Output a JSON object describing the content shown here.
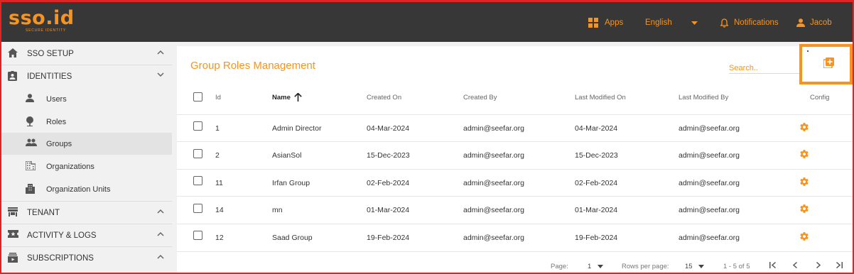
{
  "header": {
    "logo_text": "sso.id",
    "logo_tagline": "SECURE IDENTITY",
    "apps_label": "Apps",
    "language_label": "English",
    "notifications_label": "Notifications",
    "user_label": "Jacob",
    "accent_color": "#f7931e",
    "bar_color": "#373737"
  },
  "sidebar": {
    "items": [
      {
        "label": "SSO SETUP",
        "icon": "home-icon",
        "chevron": "chevron-up-icon"
      },
      {
        "label": "IDENTITIES",
        "icon": "id-badge-icon",
        "chevron": "chevron-down-icon"
      },
      {
        "label": "Users",
        "icon": "person-icon"
      },
      {
        "label": "Roles",
        "icon": "pin-icon"
      },
      {
        "label": "Groups",
        "icon": "people-icon",
        "active": true
      },
      {
        "label": "Organizations",
        "icon": "building-icon"
      },
      {
        "label": "Organization Units",
        "icon": "buildings-icon"
      },
      {
        "label": "TENANT",
        "icon": "store-icon",
        "chevron": "chevron-up-icon"
      },
      {
        "label": "ACTIVITY & LOGS",
        "icon": "ticket-icon",
        "chevron": "chevron-up-icon"
      },
      {
        "label": "SUBSCRIPTIONS",
        "icon": "subscriptions-icon",
        "chevron": "chevron-up-icon"
      }
    ]
  },
  "main": {
    "title": "Group Roles Management",
    "search_placeholder": "Search..",
    "add_button_icon": "add-box-icon"
  },
  "table": {
    "columns": [
      "Id",
      "Name",
      "Created On",
      "Created By",
      "Last Modified On",
      "Last Modified By",
      "Config"
    ],
    "sort_column": "Name",
    "sort_icon": "arrow-up-icon",
    "rows": [
      {
        "id": "1",
        "name": "Admin Director",
        "created_on": "04-Mar-2024",
        "created_by": "admin@seefar.org",
        "modified_on": "04-Mar-2024",
        "modified_by": "admin@seefar.org"
      },
      {
        "id": "2",
        "name": "AsianSol",
        "created_on": "15-Dec-2023",
        "created_by": "admin@seefar.org",
        "modified_on": "15-Dec-2023",
        "modified_by": "admin@seefar.org"
      },
      {
        "id": "11",
        "name": "Irfan Group",
        "created_on": "02-Feb-2024",
        "created_by": "admin@seefar.org",
        "modified_on": "02-Feb-2024",
        "modified_by": "admin@seefar.org"
      },
      {
        "id": "14",
        "name": "mn",
        "created_on": "01-Mar-2024",
        "created_by": "admin@seefar.org",
        "modified_on": "01-Mar-2024",
        "modified_by": "admin@seefar.org"
      },
      {
        "id": "12",
        "name": "Saad Group",
        "created_on": "19-Feb-2024",
        "created_by": "admin@seefar.org",
        "modified_on": "19-Feb-2024",
        "modified_by": "admin@seefar.org"
      }
    ]
  },
  "pagination": {
    "page_label": "Page:",
    "page_value": "1",
    "rows_label": "Rows per page:",
    "rows_value": "15",
    "range_text": "1 - 5 of 5"
  }
}
